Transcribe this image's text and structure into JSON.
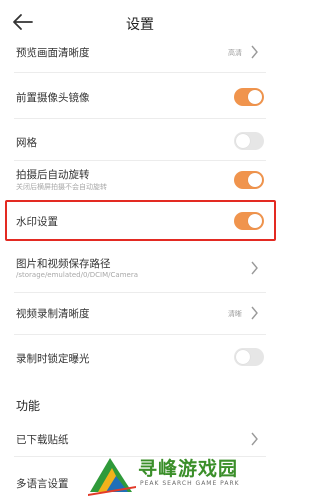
{
  "header": {
    "title": "设置"
  },
  "rows": {
    "preview_quality": {
      "label": "预览画面清晰度",
      "value": "高清"
    },
    "front_mirror": {
      "label": "前置摄像头镜像",
      "on": true
    },
    "grid": {
      "label": "网格",
      "on": false
    },
    "auto_rotate": {
      "label": "拍摄后自动旋转",
      "sub": "关闭后横屏拍摄不会自动旋转",
      "on": true
    },
    "watermark": {
      "label": "水印设置",
      "on": true
    },
    "save_path": {
      "label": "图片和视频保存路径",
      "sub": "/storage/emulated/0/DCIM/Camera"
    },
    "video_quality": {
      "label": "视频录制清晰度",
      "value": "清晰"
    },
    "lock_exposure": {
      "label": "录制时锁定曝光",
      "on": false
    }
  },
  "section": {
    "title": "功能"
  },
  "func_rows": {
    "downloaded_stickers": {
      "label": "已下载贴纸"
    },
    "language": {
      "label": "多语言设置"
    }
  },
  "watermark_logo": {
    "name": "寻峰游戏园",
    "sub": "PEAK SEARCH GAME PARK"
  },
  "colors": {
    "accent": "#f0944d",
    "highlight": "#e32a22",
    "toggle_off": "#e6e6e6"
  }
}
